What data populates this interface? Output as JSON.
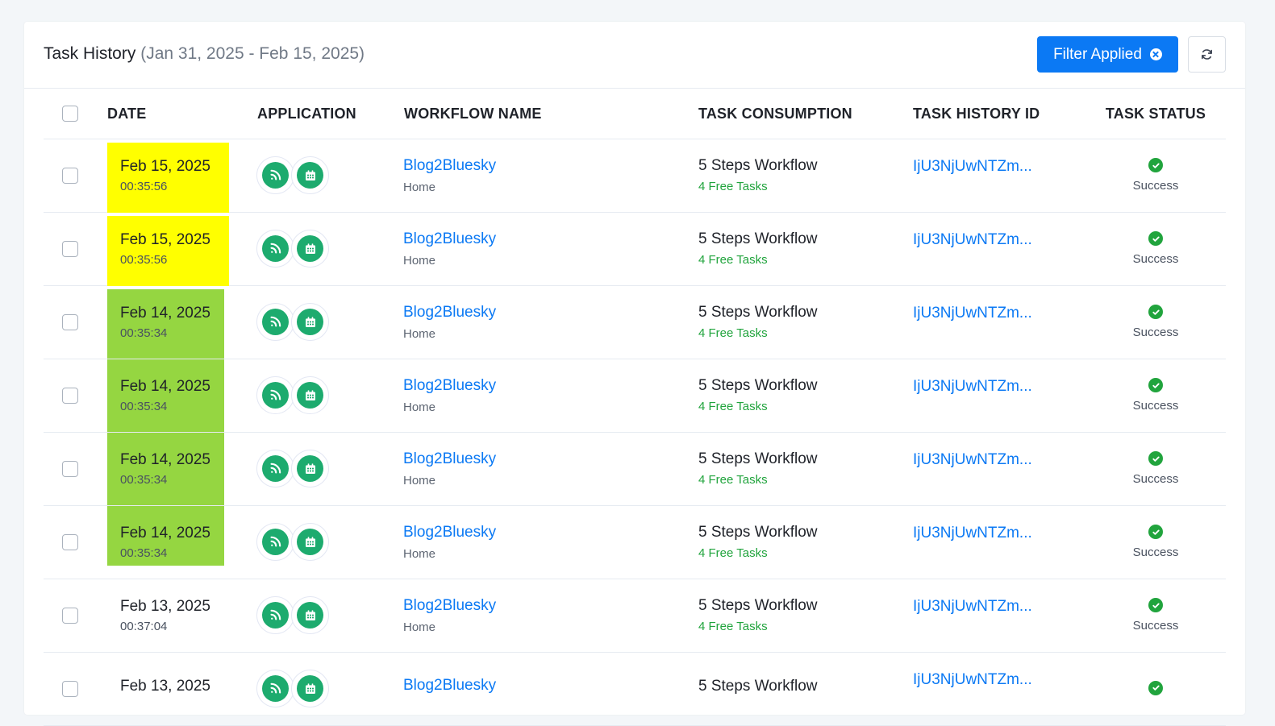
{
  "header": {
    "title": "Task History",
    "date_range": "(Jan 31, 2025 - Feb 15, 2025)",
    "filter_label": "Filter Applied"
  },
  "columns": {
    "date": "DATE",
    "application": "APPLICATION",
    "workflow_name": "WORKFLOW NAME",
    "task_consumption": "TASK CONSUMPTION",
    "task_history_id": "TASK HISTORY ID",
    "task_status": "TASK STATUS"
  },
  "highlight_colors": {
    "yellow": "#ffff00",
    "green": "#95d641"
  },
  "app_icons": [
    "rss-icon",
    "calendar-icon"
  ],
  "rows": [
    {
      "date": "Feb 15, 2025",
      "time": "00:35:56",
      "highlight": "yellow",
      "workflow": "Blog2Bluesky",
      "folder": "Home",
      "consumption": "5 Steps Workflow",
      "free_tasks": "4 Free Tasks",
      "history_id": "IjU3NjUwNTZm...",
      "status": "Success"
    },
    {
      "date": "Feb 15, 2025",
      "time": "00:35:56",
      "highlight": "yellow",
      "workflow": "Blog2Bluesky",
      "folder": "Home",
      "consumption": "5 Steps Workflow",
      "free_tasks": "4 Free Tasks",
      "history_id": "IjU3NjUwNTZm...",
      "status": "Success"
    },
    {
      "date": "Feb 14, 2025",
      "time": "00:35:34",
      "highlight": "green",
      "workflow": "Blog2Bluesky",
      "folder": "Home",
      "consumption": "5 Steps Workflow",
      "free_tasks": "4 Free Tasks",
      "history_id": "IjU3NjUwNTZm...",
      "status": "Success"
    },
    {
      "date": "Feb 14, 2025",
      "time": "00:35:34",
      "highlight": "green",
      "workflow": "Blog2Bluesky",
      "folder": "Home",
      "consumption": "5 Steps Workflow",
      "free_tasks": "4 Free Tasks",
      "history_id": "IjU3NjUwNTZm...",
      "status": "Success"
    },
    {
      "date": "Feb 14, 2025",
      "time": "00:35:34",
      "highlight": "green",
      "workflow": "Blog2Bluesky",
      "folder": "Home",
      "consumption": "5 Steps Workflow",
      "free_tasks": "4 Free Tasks",
      "history_id": "IjU3NjUwNTZm...",
      "status": "Success"
    },
    {
      "date": "Feb 14, 2025",
      "time": "00:35:34",
      "highlight": "green",
      "workflow": "Blog2Bluesky",
      "folder": "Home",
      "consumption": "5 Steps Workflow",
      "free_tasks": "4 Free Tasks",
      "history_id": "IjU3NjUwNTZm...",
      "status": "Success"
    },
    {
      "date": "Feb 13, 2025",
      "time": "00:37:04",
      "highlight": "",
      "workflow": "Blog2Bluesky",
      "folder": "Home",
      "consumption": "5 Steps Workflow",
      "free_tasks": "4 Free Tasks",
      "history_id": "IjU3NjUwNTZm...",
      "status": "Success"
    },
    {
      "date": "Feb 13, 2025",
      "time": "",
      "highlight": "",
      "workflow": "Blog2Bluesky",
      "folder": "",
      "consumption": "5 Steps Workflow",
      "free_tasks": "",
      "history_id": "IjU3NjUwNTZm...",
      "status": ""
    }
  ]
}
